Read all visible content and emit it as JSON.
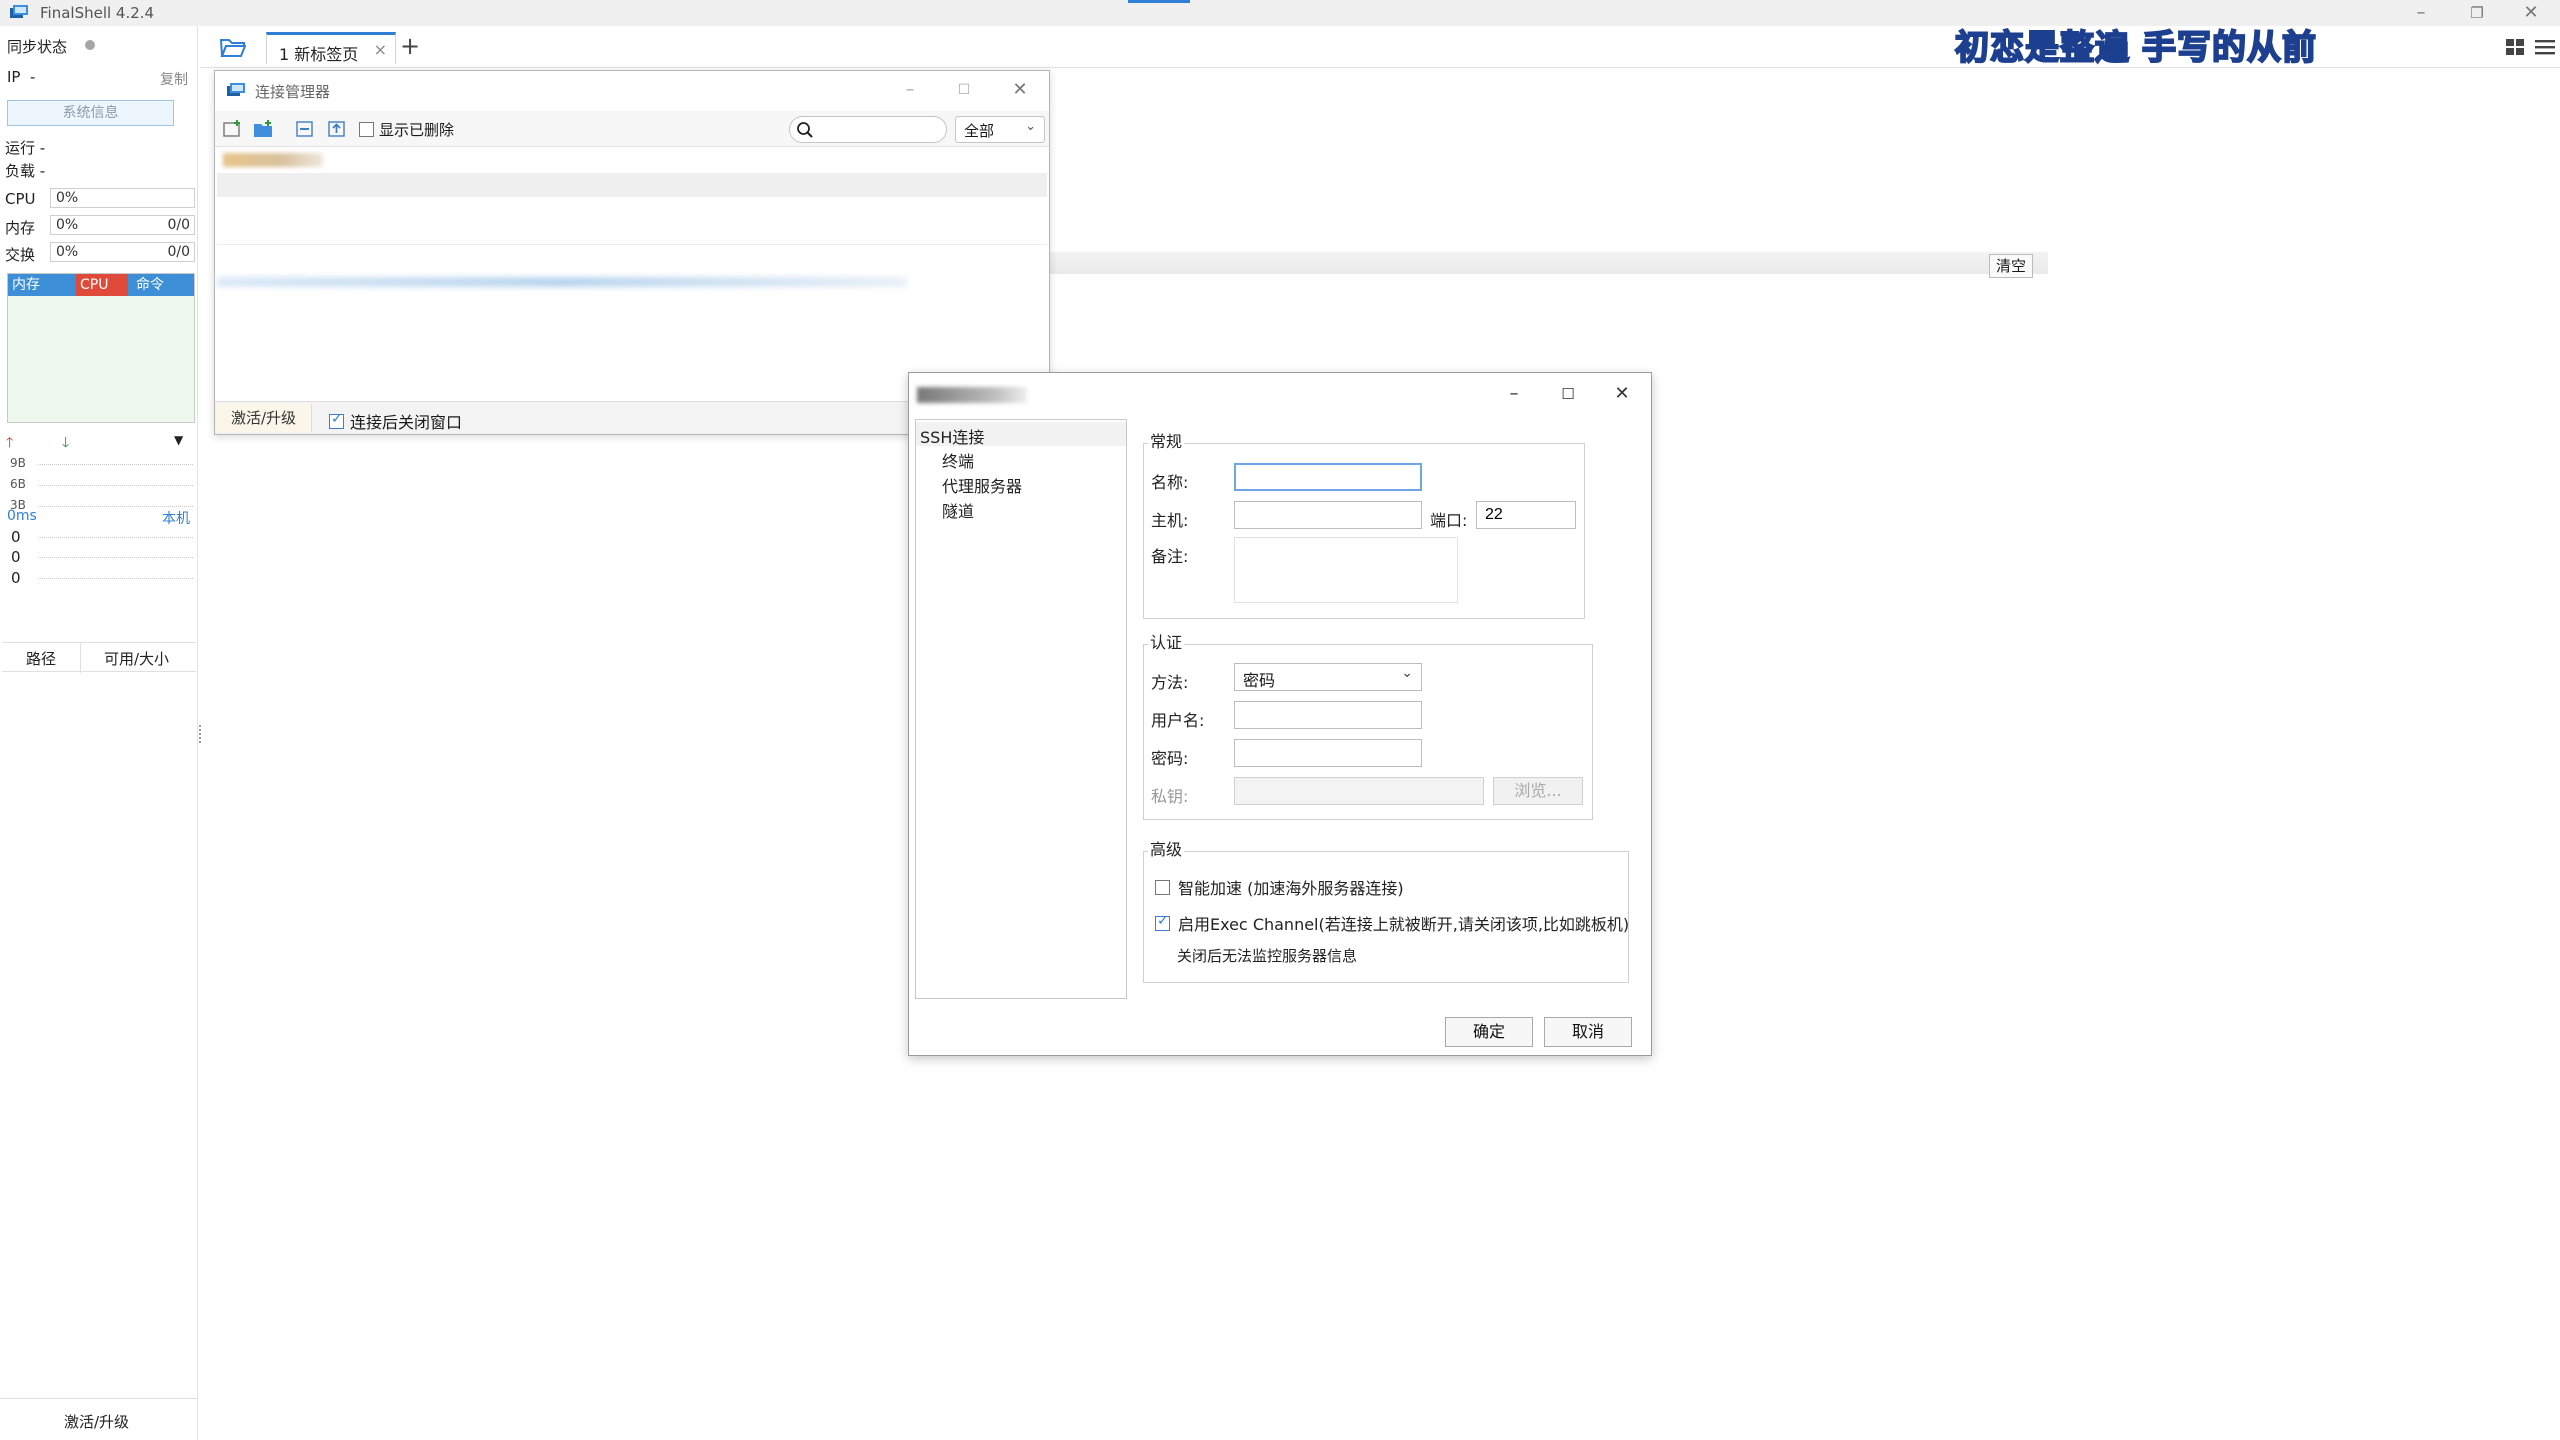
{
  "window": {
    "title": "FinalShell 4.2.4"
  },
  "left_panel": {
    "sync_label": "同步状态",
    "ip_label": "IP",
    "ip_value": "-",
    "copy_label": "复制",
    "sysinfo_button": "系统信息",
    "run_label": "运行 -",
    "load_label": "负载 -",
    "cpu_label": "CPU",
    "cpu_value": "0%",
    "mem_label": "内存",
    "mem_value": "0%",
    "mem_sub": "0/0",
    "swap_label": "交换",
    "swap_value": "0%",
    "swap_sub": "0/0",
    "proc_tabs": [
      "内存",
      "CPU",
      "命令"
    ],
    "net_ticks": [
      "9B",
      "6B",
      "3B"
    ],
    "latency_label": "0ms",
    "local_label": "本机",
    "latency_values": [
      "0",
      "0",
      "0"
    ],
    "disk_cols": [
      "路径",
      "可用/大小"
    ],
    "activate_label": "激活/升级"
  },
  "tabbar": {
    "tabs": [
      {
        "label": "1 新标签页",
        "close": "×"
      }
    ],
    "add_tab": "+",
    "banner": [
      "初恋是整遍",
      "手写的从前"
    ]
  },
  "middle": {
    "clear_button": "清空"
  },
  "connection_manager": {
    "title": "连接管理器",
    "show_deleted_label": "显示已删除",
    "show_deleted_checked": false,
    "search_placeholder": "",
    "filter_value": "全部",
    "activate_label": "激活/升级",
    "close_after_connect_label": "连接后关闭窗口",
    "close_after_connect_checked": true
  },
  "new_connection": {
    "tree": {
      "root": "SSH连接",
      "children": [
        "终端",
        "代理服务器",
        "隧道"
      ]
    },
    "general": {
      "title": "常规",
      "name_label": "名称:",
      "name_value": "",
      "host_label": "主机:",
      "host_value": "",
      "port_label": "端口:",
      "port_value": "22",
      "note_label": "备注:",
      "note_value": ""
    },
    "auth": {
      "title": "认证",
      "method_label": "方法:",
      "method_value": "密码",
      "username_label": "用户名:",
      "username_value": "",
      "password_label": "密码:",
      "password_value": "",
      "key_label": "私钥:",
      "key_value": "",
      "browse_label": "浏览..."
    },
    "advanced": {
      "title": "高级",
      "smart_accel_label": "智能加速 (加速海外服务器连接)",
      "smart_accel_checked": false,
      "exec_channel_label": "启用Exec Channel(若连接上就被断开,请关闭该项,比如跳板机)",
      "exec_channel_checked": true,
      "exec_channel_note": "关闭后无法监控服务器信息"
    },
    "ok_label": "确定",
    "cancel_label": "取消"
  },
  "colors": {
    "accent": "#2f7fd6",
    "cpu_tab": "#e04a3a",
    "proc_header": "#3c8fd6",
    "banner_text": "#ffd21a"
  }
}
